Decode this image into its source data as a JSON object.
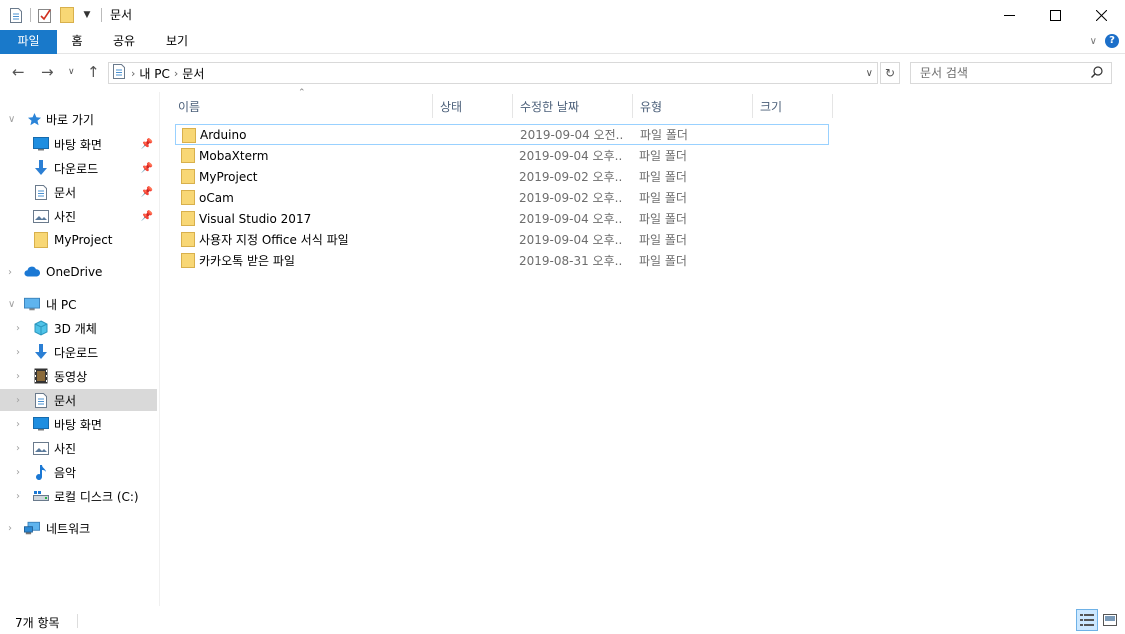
{
  "window": {
    "title": "문서"
  },
  "ribbon": {
    "tabs": [
      "파일",
      "홈",
      "공유",
      "보기"
    ]
  },
  "address": {
    "crumbs": [
      "내 PC",
      "문서"
    ]
  },
  "search": {
    "placeholder": "문서 검색"
  },
  "nav": {
    "quick_access": "바로 가기",
    "pinned": [
      "바탕 화면",
      "다운로드",
      "문서",
      "사진"
    ],
    "recent": "MyProject",
    "onedrive": "OneDrive",
    "this_pc": "내 PC",
    "pc_items": [
      "3D 개체",
      "다운로드",
      "동영상",
      "문서",
      "바탕 화면",
      "사진",
      "음악",
      "로컬 디스크 (C:)"
    ],
    "network": "네트워크"
  },
  "columns": [
    "이름",
    "상태",
    "수정한 날짜",
    "유형",
    "크기"
  ],
  "files": [
    {
      "name": "Arduino",
      "date": "2019-09-04 오전...",
      "type": "파일 폴더"
    },
    {
      "name": "MobaXterm",
      "date": "2019-09-04 오후...",
      "type": "파일 폴더"
    },
    {
      "name": "MyProject",
      "date": "2019-09-02 오후...",
      "type": "파일 폴더"
    },
    {
      "name": "oCam",
      "date": "2019-09-02 오후...",
      "type": "파일 폴더"
    },
    {
      "name": "Visual Studio 2017",
      "date": "2019-09-04 오후...",
      "type": "파일 폴더"
    },
    {
      "name": "사용자 지정 Office 서식 파일",
      "date": "2019-09-04 오후...",
      "type": "파일 폴더"
    },
    {
      "name": "카카오톡 받은 파일",
      "date": "2019-08-31 오후...",
      "type": "파일 폴더"
    }
  ],
  "status": {
    "count": "7개 항목"
  },
  "colors": {
    "accent": "#1979ca",
    "folder": "#f8d775",
    "selection": "#cce8ff"
  }
}
